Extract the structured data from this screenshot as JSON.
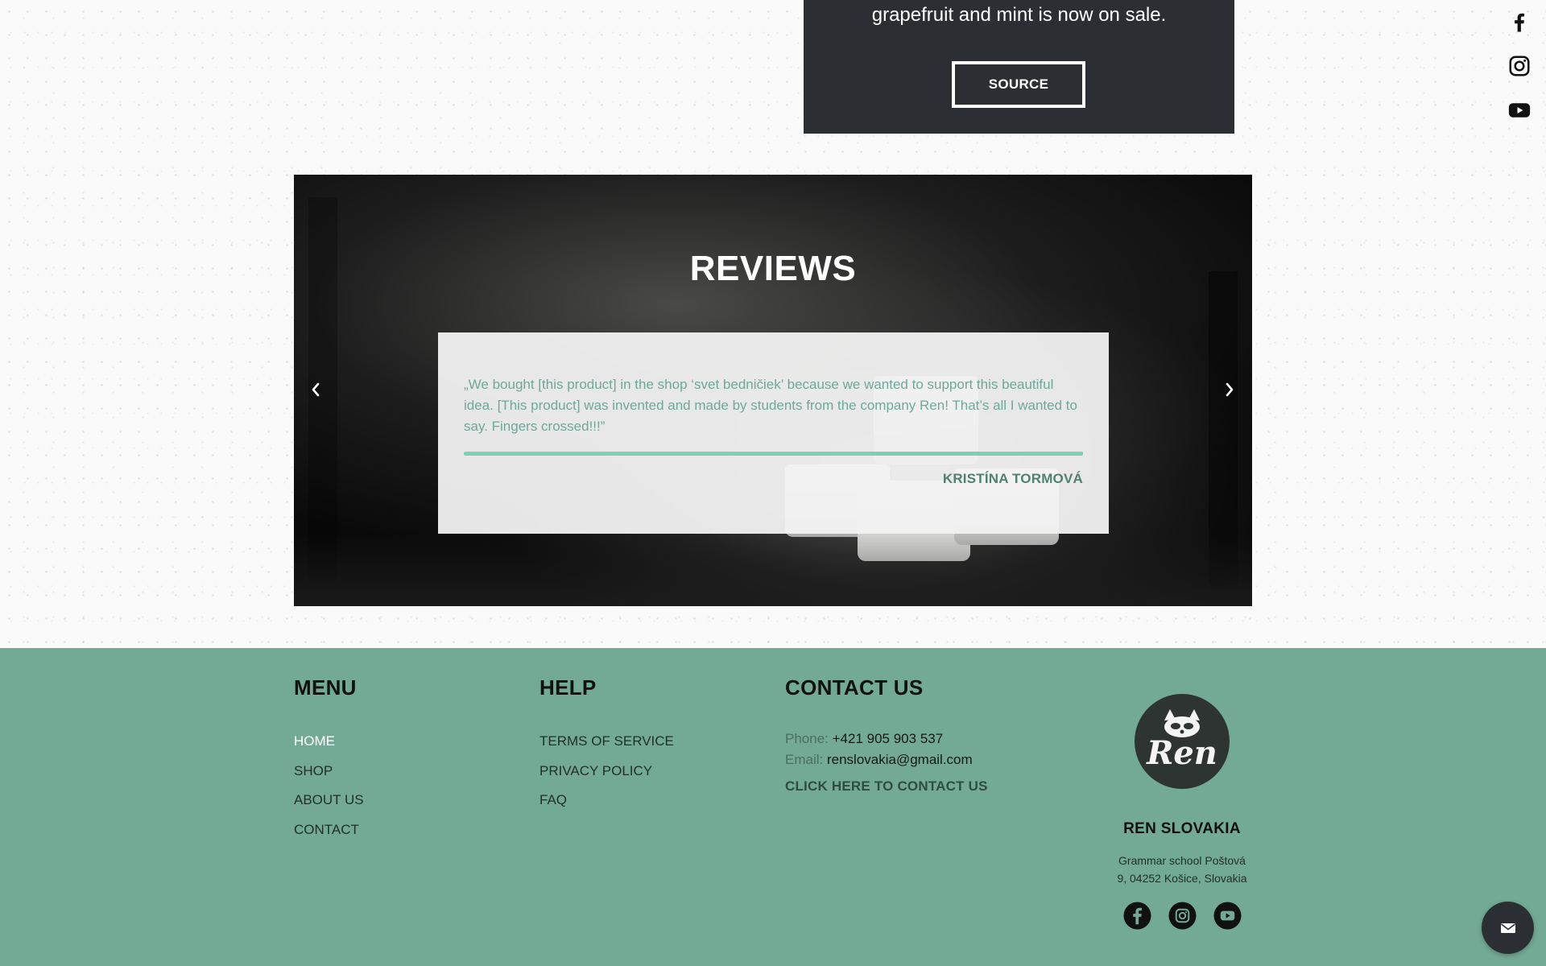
{
  "promo": {
    "text": "grapefruit and mint is now on sale.",
    "button_label": "SOURCE"
  },
  "social_rail": {
    "icons": [
      "facebook-icon",
      "instagram-icon",
      "youtube-icon"
    ]
  },
  "reviews": {
    "title": "REVIEWS",
    "quote": "„We bought [this product] in the shop ‘svet bedničiek’ because we wanted to support this beautiful idea. [This product] was invented and made by students from the company Ren! That’s all I wanted to say. Fingers crossed!!!”",
    "author": "KRISTÍNA TORMOVÁ",
    "prev_icon": "chevron-left-icon",
    "next_icon": "chevron-right-icon"
  },
  "footer": {
    "menu": {
      "title": "MENU",
      "items": [
        "HOME",
        "SHOP",
        "ABOUT US",
        "CONTACT"
      ],
      "active": "HOME"
    },
    "help": {
      "title": "HELP",
      "items": [
        "TERMS OF SERVICE",
        "PRIVACY POLICY",
        "FAQ"
      ]
    },
    "contact": {
      "title": "CONTACT US",
      "phone_label": "Phone:",
      "phone": "+421 905 903 537",
      "email_label": "Email:",
      "email": "renslovakia@gmail.com",
      "cta": "CLICK HERE TO CONTACT US"
    },
    "brand": {
      "logo_text": "Ren",
      "name": "REN SLOVAKIA",
      "address_line1": "Grammar school Poštová",
      "address_line2": "9, 04252 Košice, Slovakia"
    }
  },
  "colors": {
    "footer_bg": "#73aa95",
    "accent": "#7dd0b6",
    "dark": "#2b2f33"
  }
}
